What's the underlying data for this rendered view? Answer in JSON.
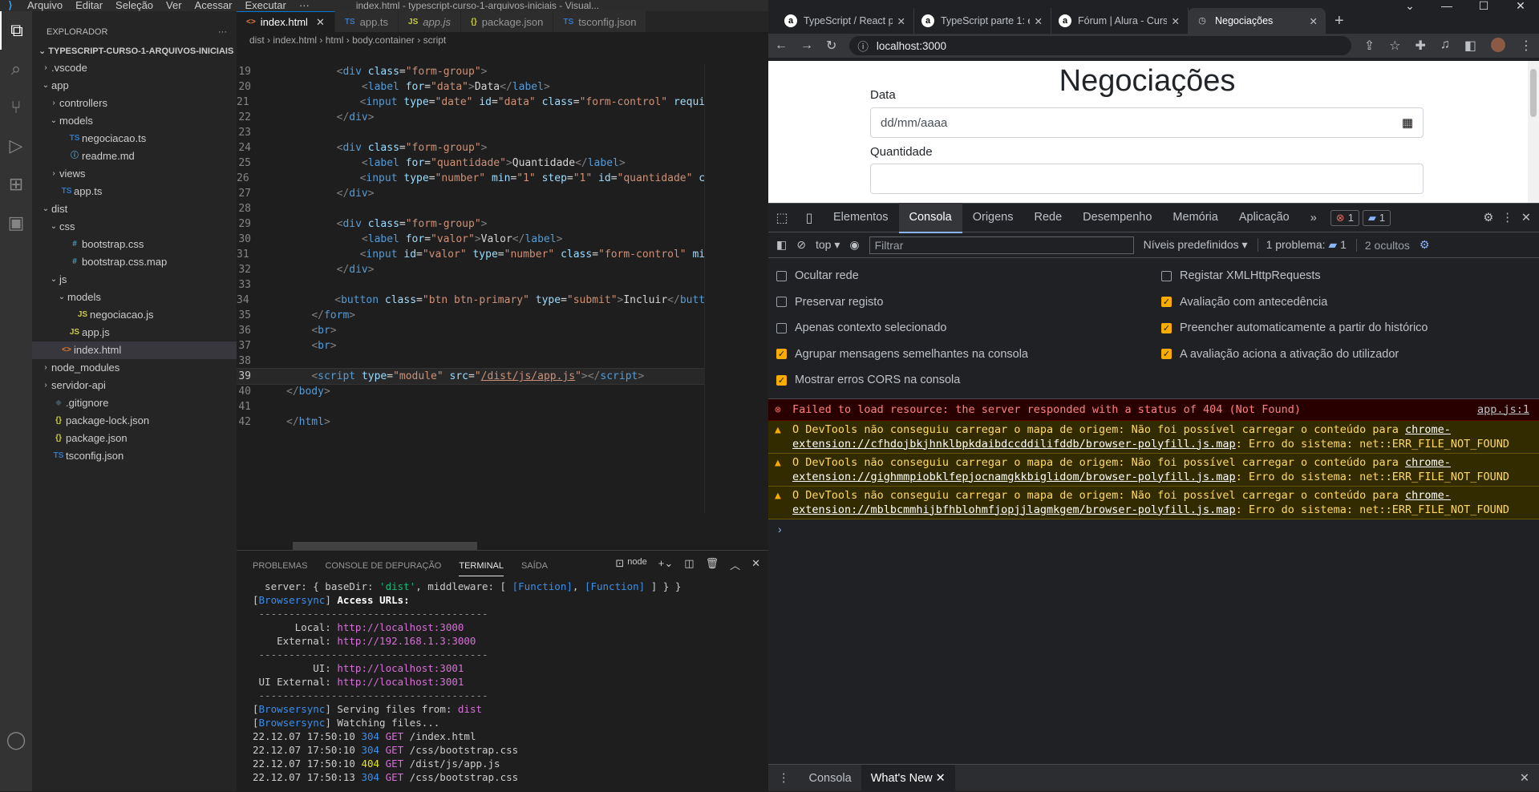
{
  "vscode": {
    "menu": [
      "Arquivo",
      "Editar",
      "Seleção",
      "Ver",
      "Acessar",
      "Executar",
      "···"
    ],
    "window_title": "index.html - typescript-curso-1-arquivos-iniciais - Visual...",
    "explorer": {
      "header": "EXPLORADOR",
      "more": "···",
      "root": "TYPESCRIPT-CURSO-1-ARQUIVOS-INICIAIS",
      "items": [
        {
          "label": ".vscode",
          "indent": 1,
          "chev": "›",
          "icon": "",
          "color": "#ccc"
        },
        {
          "label": "app",
          "indent": 1,
          "chev": "⌄",
          "icon": "",
          "color": "#ccc"
        },
        {
          "label": "controllers",
          "indent": 2,
          "chev": "›",
          "icon": "",
          "color": "#ccc"
        },
        {
          "label": "models",
          "indent": 2,
          "chev": "⌄",
          "icon": "",
          "color": "#ccc"
        },
        {
          "label": "negociacao.ts",
          "indent": 3,
          "chev": "",
          "icon": "TS",
          "color": "#3178c6"
        },
        {
          "label": "readme.md",
          "indent": 3,
          "chev": "",
          "icon": "ⓘ",
          "color": "#519aba"
        },
        {
          "label": "views",
          "indent": 2,
          "chev": "›",
          "icon": "",
          "color": "#ccc"
        },
        {
          "label": "app.ts",
          "indent": 2,
          "chev": "",
          "icon": "TS",
          "color": "#3178c6"
        },
        {
          "label": "dist",
          "indent": 1,
          "chev": "⌄",
          "icon": "",
          "color": "#ccc"
        },
        {
          "label": "css",
          "indent": 2,
          "chev": "⌄",
          "icon": "",
          "color": "#ccc"
        },
        {
          "label": "bootstrap.css",
          "indent": 3,
          "chev": "",
          "icon": "#",
          "color": "#519aba"
        },
        {
          "label": "bootstrap.css.map",
          "indent": 3,
          "chev": "",
          "icon": "#",
          "color": "#519aba"
        },
        {
          "label": "js",
          "indent": 2,
          "chev": "⌄",
          "icon": "",
          "color": "#ccc"
        },
        {
          "label": "models",
          "indent": 3,
          "chev": "⌄",
          "icon": "",
          "color": "#ccc"
        },
        {
          "label": "negociacao.js",
          "indent": 4,
          "chev": "",
          "icon": "JS",
          "color": "#cbcb41"
        },
        {
          "label": "app.js",
          "indent": 3,
          "chev": "",
          "icon": "JS",
          "color": "#cbcb41"
        },
        {
          "label": "index.html",
          "indent": 2,
          "chev": "",
          "icon": "<>",
          "color": "#e37933",
          "selected": true
        },
        {
          "label": "node_modules",
          "indent": 1,
          "chev": "›",
          "icon": "",
          "color": "#ccc"
        },
        {
          "label": "servidor-api",
          "indent": 1,
          "chev": "›",
          "icon": "",
          "color": "#ccc"
        },
        {
          "label": ".gitignore",
          "indent": 1,
          "chev": "",
          "icon": "◆",
          "color": "#41535b"
        },
        {
          "label": "package-lock.json",
          "indent": 1,
          "chev": "",
          "icon": "{}",
          "color": "#cbcb41"
        },
        {
          "label": "package.json",
          "indent": 1,
          "chev": "",
          "icon": "{}",
          "color": "#cbcb41"
        },
        {
          "label": "tsconfig.json",
          "indent": 1,
          "chev": "",
          "icon": "TS",
          "color": "#3178c6"
        }
      ]
    },
    "tabs": [
      {
        "label": "index.html",
        "icon": "<>",
        "color": "#e37933",
        "active": true
      },
      {
        "label": "app.ts",
        "icon": "TS",
        "color": "#3178c6"
      },
      {
        "label": "app.js",
        "icon": "JS",
        "color": "#cbcb41",
        "italic": true
      },
      {
        "label": "package.json",
        "icon": "{}",
        "color": "#cbcb41"
      },
      {
        "label": "tsconfig.json",
        "icon": "TS",
        "color": "#3178c6"
      }
    ],
    "breadcrumb": [
      "dist",
      "index.html",
      "html",
      "body.container",
      "script"
    ],
    "code": [
      {
        "n": "19",
        "html": "        <span class='p'>&lt;</span><span class='t'>div</span> <span class='a'>class</span>=<span class='s'>\"form-group\"</span><span class='p'>&gt;</span>"
      },
      {
        "n": "20",
        "html": "            <span class='p'>&lt;</span><span class='t'>label</span> <span class='a'>for</span>=<span class='s'>\"data\"</span><span class='p'>&gt;</span>Data<span class='p'>&lt;/</span><span class='t'>label</span><span class='p'>&gt;</span>"
      },
      {
        "n": "21",
        "html": "            <span class='p'>&lt;</span><span class='t'>input</span> <span class='a'>type</span>=<span class='s'>\"date\"</span> <span class='a'>id</span>=<span class='s'>\"data\"</span> <span class='a'>class</span>=<span class='s'>\"form-control\"</span> <span class='a'>requi</span>"
      },
      {
        "n": "22",
        "html": "        <span class='p'>&lt;/</span><span class='t'>div</span><span class='p'>&gt;</span>"
      },
      {
        "n": "23",
        "html": ""
      },
      {
        "n": "24",
        "html": "        <span class='p'>&lt;</span><span class='t'>div</span> <span class='a'>class</span>=<span class='s'>\"form-group\"</span><span class='p'>&gt;</span>"
      },
      {
        "n": "25",
        "html": "            <span class='p'>&lt;</span><span class='t'>label</span> <span class='a'>for</span>=<span class='s'>\"quantidade\"</span><span class='p'>&gt;</span>Quantidade<span class='p'>&lt;/</span><span class='t'>label</span><span class='p'>&gt;</span>"
      },
      {
        "n": "26",
        "html": "            <span class='p'>&lt;</span><span class='t'>input</span> <span class='a'>type</span>=<span class='s'>\"number\"</span> <span class='a'>min</span>=<span class='s'>\"1\"</span> <span class='a'>step</span>=<span class='s'>\"1\"</span> <span class='a'>id</span>=<span class='s'>\"quantidade\"</span> <span class='a'>c</span>"
      },
      {
        "n": "27",
        "html": "        <span class='p'>&lt;/</span><span class='t'>div</span><span class='p'>&gt;</span>"
      },
      {
        "n": "28",
        "html": ""
      },
      {
        "n": "29",
        "html": "        <span class='p'>&lt;</span><span class='t'>div</span> <span class='a'>class</span>=<span class='s'>\"form-group\"</span><span class='p'>&gt;</span>"
      },
      {
        "n": "30",
        "html": "            <span class='p'>&lt;</span><span class='t'>label</span> <span class='a'>for</span>=<span class='s'>\"valor\"</span><span class='p'>&gt;</span>Valor<span class='p'>&lt;/</span><span class='t'>label</span><span class='p'>&gt;</span>"
      },
      {
        "n": "31",
        "html": "            <span class='p'>&lt;</span><span class='t'>input</span> <span class='a'>id</span>=<span class='s'>\"valor\"</span> <span class='a'>type</span>=<span class='s'>\"number\"</span> <span class='a'>class</span>=<span class='s'>\"form-control\"</span> <span class='a'>mi</span>"
      },
      {
        "n": "32",
        "html": "        <span class='p'>&lt;/</span><span class='t'>div</span><span class='p'>&gt;</span>"
      },
      {
        "n": "33",
        "html": ""
      },
      {
        "n": "34",
        "html": "        <span class='p'>&lt;</span><span class='t'>button</span> <span class='a'>class</span>=<span class='s'>\"btn btn-primary\"</span> <span class='a'>type</span>=<span class='s'>\"submit\"</span><span class='p'>&gt;</span>Incluir<span class='p'>&lt;/</span><span class='t'>butt</span>"
      },
      {
        "n": "35",
        "html": "    <span class='p'>&lt;/</span><span class='t'>form</span><span class='p'>&gt;</span>"
      },
      {
        "n": "36",
        "html": "    <span class='p'>&lt;</span><span class='t'>br</span><span class='p'>&gt;</span>"
      },
      {
        "n": "37",
        "html": "    <span class='p'>&lt;</span><span class='t'>br</span><span class='p'>&gt;</span>"
      },
      {
        "n": "38",
        "html": ""
      },
      {
        "n": "39",
        "html": "    <span class='p'>&lt;</span><span class='t'>script</span> <span class='a'>type</span>=<span class='s'>\"module\"</span> <span class='a'>src</span>=<span class='s'>\"<u>/dist/js/app.js</u>\"</span><span class='p'>&gt;&lt;/</span><span class='t'>script</span><span class='p'>&gt;</span>",
        "current": true
      },
      {
        "n": "40",
        "html": "<span class='p'>&lt;/</span><span class='t'>body</span><span class='p'>&gt;</span>"
      },
      {
        "n": "41",
        "html": ""
      },
      {
        "n": "42",
        "html": "<span class='p'>&lt;/</span><span class='t'>html</span><span class='p'>&gt;</span>"
      }
    ],
    "panel": {
      "tabs": [
        "PROBLEMAS",
        "CONSOLE DE DEPURAÇÃO",
        "TERMINAL",
        "SAÍDA"
      ],
      "active": "TERMINAL",
      "terminal_name": "node",
      "lines": [
        "  server: { baseDir: <span class='gn'>'dist'</span>, middleware: [ <span class='cy'>[Function]</span>, <span class='cy'>[Function]</span> ] } }",
        "[<span class='bs'>Browsersync</span>] <span class='wb'>Access URLs:</span>",
        "<span class='gy'> --------------------------------------</span>",
        "       Local: <span class='mg'>http://localhost:3000</span>",
        "    External: <span class='mg'>http://192.168.1.3:3000</span>",
        "<span class='gy'> --------------------------------------</span>",
        "          UI: <span class='mg'>http://localhost:3001</span>",
        " UI External: <span class='mg'>http://localhost:3001</span>",
        "<span class='gy'> --------------------------------------</span>",
        "[<span class='bs'>Browsersync</span>] Serving files from: <span class='mg'>dist</span>",
        "[<span class='bs'>Browsersync</span>] Watching files...",
        "22.12.07 17:50:10 <span class='cy'>304</span> <span class='mg'>GET</span> /index.html",
        "22.12.07 17:50:10 <span class='cy'>304</span> <span class='mg'>GET</span> /css/bootstrap.css",
        "22.12.07 17:50:10 <span class='yl'>404</span> <span class='mg'>GET</span> /dist/js/app.js",
        "22.12.07 17:50:13 <span class='cy'>304</span> <span class='mg'>GET</span> /css/bootstrap.css"
      ]
    }
  },
  "chrome": {
    "tabs": [
      {
        "label": "TypeScript / React p",
        "fav": "a"
      },
      {
        "label": "TypeScript parte 1: e",
        "fav": "a"
      },
      {
        "label": "Fórum | Alura - Curs",
        "fav": "a"
      },
      {
        "label": "Negociações",
        "fav": "◷",
        "active": true
      }
    ],
    "url": "localhost:3000",
    "page": {
      "title": "Negociações",
      "label_data": "Data",
      "date_placeholder": "dd/mm/aaaa",
      "label_qty": "Quantidade"
    },
    "devtools": {
      "tabs": [
        "Elementos",
        "Consola",
        "Origens",
        "Rede",
        "Desempenho",
        "Memória",
        "Aplicação"
      ],
      "active": "Consola",
      "more": "»",
      "errors": "1",
      "messages": "1",
      "context": "top",
      "filter_placeholder": "Filtrar",
      "levels": "Níveis predefinidos",
      "problems": "1 problema:",
      "problems_count": "1",
      "hidden": "2 ocultos",
      "settings_left": [
        {
          "label": "Ocultar rede",
          "on": false
        },
        {
          "label": "Preservar registo",
          "on": false
        },
        {
          "label": "Apenas contexto selecionado",
          "on": false
        },
        {
          "label": "Agrupar mensagens semelhantes na consola",
          "on": true
        },
        {
          "label": "Mostrar erros CORS na consola",
          "on": true
        }
      ],
      "settings_right": [
        {
          "label": "Registar XMLHttpRequests",
          "on": false
        },
        {
          "label": "Avaliação com antecedência",
          "on": true
        },
        {
          "label": "Preencher automaticamente a partir do histórico",
          "on": true
        },
        {
          "label": "A avaliação aciona a ativação do utilizador",
          "on": true
        }
      ],
      "error_msg": "Failed to load resource: the server responded with a status of 404 (Not Found)",
      "error_src": "app.js:1",
      "warnings": [
        "O DevTools não conseguiu carregar o mapa de origem: Não foi possível carregar o conteúdo para <u>chrome-extension://cfhdojbkjhnklbpkdaibdccddilifddb/browser-polyfill.js.map</u>: Erro do sistema: net::ERR_FILE_NOT_FOUND",
        "O DevTools não conseguiu carregar o mapa de origem: Não foi possível carregar o conteúdo para <u>chrome-extension://gighmmpiobklfepjocnamgkkbiglidom/browser-polyfill.js.map</u>: Erro do sistema: net::ERR_FILE_NOT_FOUND",
        "O DevTools não conseguiu carregar o mapa de origem: Não foi possível carregar o conteúdo para <u>chrome-extension://mblbcmmhijbfhblohmfjopjjlagmkgem/browser-polyfill.js.map</u>: Erro do sistema: net::ERR_FILE_NOT_FOUND"
      ],
      "prompt": "›",
      "drawer_tabs": [
        "Consola",
        "What's New"
      ],
      "drawer_active": "What's New"
    }
  }
}
